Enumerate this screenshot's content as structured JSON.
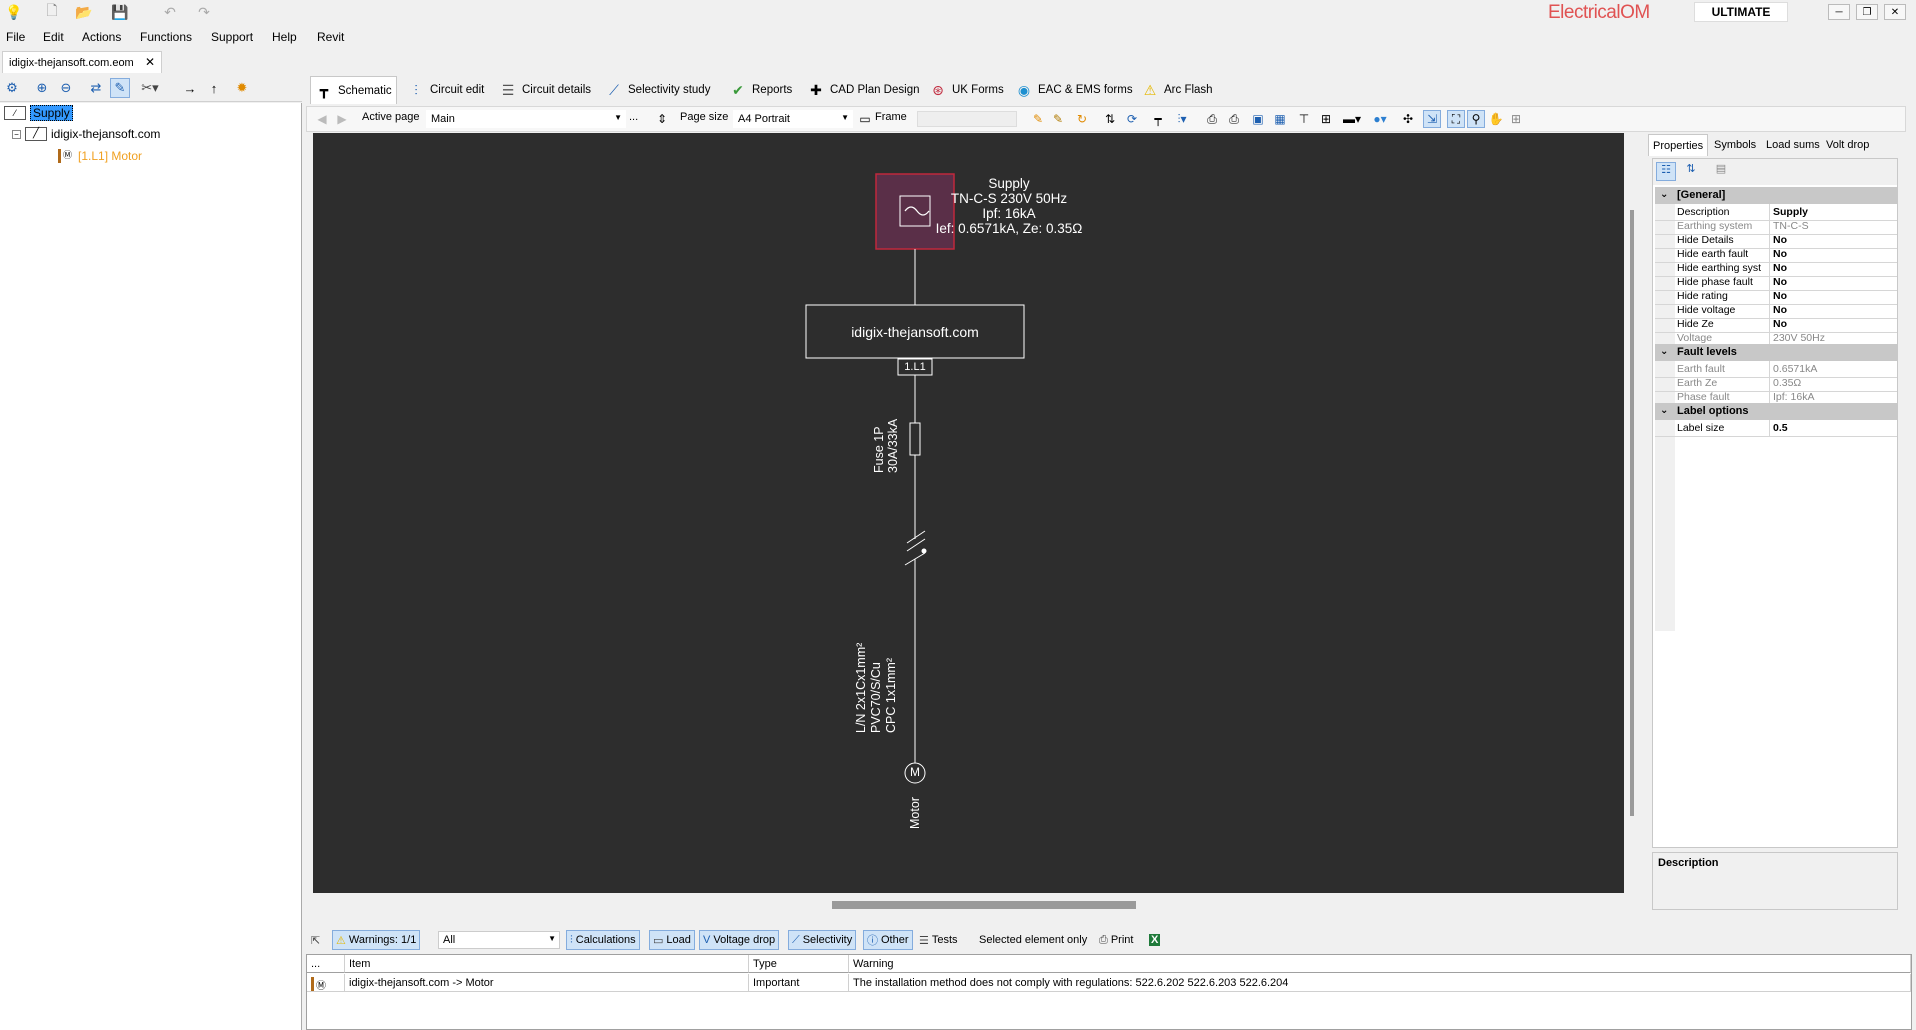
{
  "titlebar": {
    "brand": "ElectricalOM",
    "edition": "ULTIMATE",
    "window_controls": [
      "minimize",
      "restore",
      "close"
    ]
  },
  "menu": [
    "File",
    "Edit",
    "Actions",
    "Functions",
    "Support",
    "Help",
    "Revit"
  ],
  "document_tab": {
    "label": "idigix-thejansoft.com.eom",
    "close": "✕"
  },
  "tree": {
    "nodes": [
      {
        "label": "Supply",
        "icon": "supply-icon",
        "selected": true
      },
      {
        "label": "idigix-thejansoft.com",
        "icon": "board-icon"
      },
      {
        "label": "[1.L1] Motor",
        "icon": "motor-icon"
      }
    ]
  },
  "main_tabs": [
    {
      "label": "Schematic",
      "icon": "schematic-icon",
      "active": true
    },
    {
      "label": "Circuit edit",
      "icon": "circuit-edit-icon"
    },
    {
      "label": "Circuit details",
      "icon": "circuit-details-icon"
    },
    {
      "label": "Selectivity study",
      "icon": "selectivity-icon"
    },
    {
      "label": "Reports",
      "icon": "reports-icon"
    },
    {
      "label": "CAD Plan Design",
      "icon": "cad-icon"
    },
    {
      "label": "UK Forms",
      "icon": "uk-flag-icon"
    },
    {
      "label": "EAC & EMS forms",
      "icon": "eac-icon"
    },
    {
      "label": "Arc Flash",
      "icon": "warning-icon"
    }
  ],
  "page_toolbar": {
    "active_page_label": "Active page",
    "active_page_value": "Main",
    "ellipsis": "...",
    "page_size_label": "Page size",
    "page_size_value": "A4 Portrait",
    "frame_label": "Frame"
  },
  "schematic": {
    "supply": {
      "title": "Supply",
      "line1": "TN-C-S 230V 50Hz",
      "line2": "Ipf: 16kA",
      "line3": "Ief: 0.6571kA, Ze: 0.35Ω"
    },
    "board": "idigix-thejansoft.com",
    "circuit_ref": "1.L1",
    "fuse": [
      "Fuse 1P",
      "30A/33kA"
    ],
    "cable": [
      "L/N 2x1Cx1mm²",
      "PVC70/S/Cu",
      "CPC 1x1mm²"
    ],
    "motor_symbol": "M",
    "motor_label": "Motor"
  },
  "prop_tabs": [
    "Properties",
    "Symbols",
    "Load sums",
    "Volt drop"
  ],
  "properties": {
    "categories": [
      {
        "name": "[General]",
        "rows": [
          {
            "k": "Description",
            "v": "Supply",
            "ro": false
          },
          {
            "k": "Earthing system",
            "v": "TN-C-S",
            "ro": true
          },
          {
            "k": "Hide Details",
            "v": "No",
            "ro": false
          },
          {
            "k": "Hide earth fault",
            "v": "No",
            "ro": false
          },
          {
            "k": "Hide earthing syst",
            "v": "No",
            "ro": false
          },
          {
            "k": "Hide phase fault",
            "v": "No",
            "ro": false
          },
          {
            "k": "Hide rating",
            "v": "No",
            "ro": false
          },
          {
            "k": "Hide voltage",
            "v": "No",
            "ro": false
          },
          {
            "k": "Hide Ze",
            "v": "No",
            "ro": false
          },
          {
            "k": "Voltage",
            "v": "230V 50Hz",
            "ro": true
          }
        ]
      },
      {
        "name": "Fault levels",
        "rows": [
          {
            "k": "Earth fault",
            "v": "0.6571kA",
            "ro": true
          },
          {
            "k": "Earth Ze",
            "v": "0.35Ω",
            "ro": true
          },
          {
            "k": "Phase fault",
            "v": "Ipf: 16kA",
            "ro": true
          }
        ]
      },
      {
        "name": "Label options",
        "rows": [
          {
            "k": "Label size",
            "v": "0.5",
            "ro": false
          }
        ]
      }
    ],
    "description_title": "Description"
  },
  "bottom_toolbar": {
    "warnings": "Warnings: 1/1",
    "filter": "All",
    "calculations": "Calculations",
    "load": "Load",
    "voltage_drop": "Voltage drop",
    "selectivity": "Selectivity",
    "other": "Other",
    "tests": "Tests",
    "selected_only": "Selected element only",
    "print": "Print"
  },
  "warnings_table": {
    "headers": [
      "...",
      "Item",
      "Type",
      "Warning"
    ],
    "rows": [
      {
        "item": "idigix-thejansoft.com -> Motor",
        "type": "Important",
        "warning": "The installation method does not comply with regulations: 522.6.202 522.6.203 522.6.204"
      }
    ]
  },
  "colors": {
    "canvas": "#2d2d2d",
    "supply_box_fill": "#5a2f48",
    "supply_box_border": "#c0283c",
    "tree_selected": "#3399ff",
    "motor_node": "#f0a020",
    "brand": "#e05252"
  }
}
